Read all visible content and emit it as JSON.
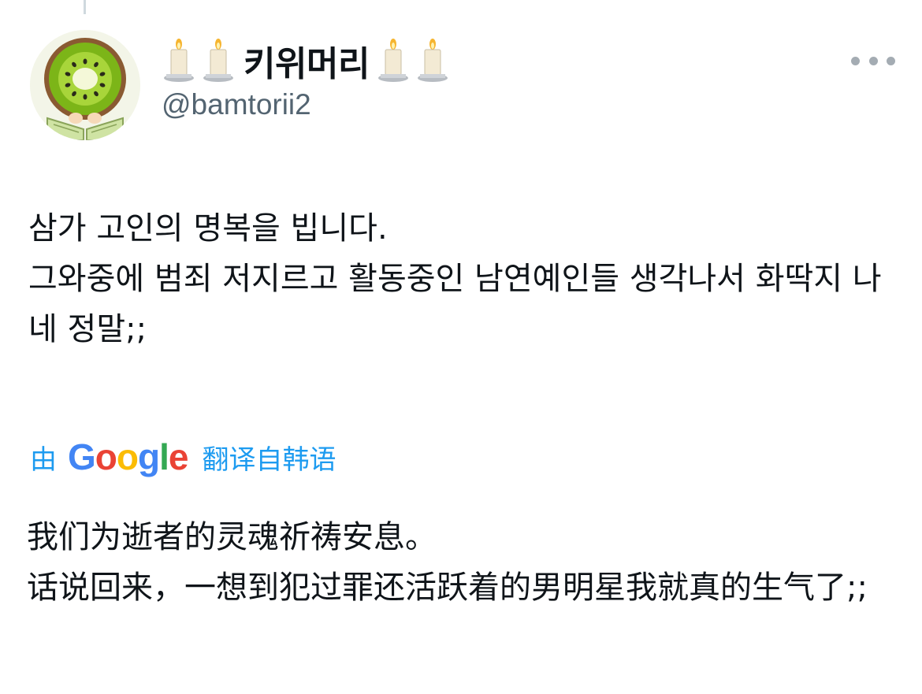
{
  "author": {
    "display_name": "키위머리",
    "handle": "@bamtorii2",
    "avatar_icon": "kiwi-avatar-icon",
    "name_decoration_icon": "candle-icon"
  },
  "actions": {
    "more_icon": "more-horizontal-icon"
  },
  "tweet": {
    "lines": [
      "삼가 고인의 명복을 빕니다.",
      "그와중에 범죄 저지르고 활동중인 남연예인들 생각나서 화딱지 나네 정말;;"
    ]
  },
  "translation": {
    "by_label": "由",
    "provider": {
      "letters": [
        "G",
        "o",
        "o",
        "g",
        "l",
        "e"
      ],
      "colors": [
        "#4285f4",
        "#ea4335",
        "#fbbc05",
        "#4285f4",
        "#34a853",
        "#ea4335"
      ]
    },
    "source_label": "翻译自韩语",
    "lines": [
      "我们为逝者的灵魂祈祷安息。",
      "话说回来，一想到犯过罪还活跃着的男明星我就真的生气了;;"
    ]
  },
  "colors": {
    "link": "#1d9bf0",
    "text": "#0f1419",
    "secondary": "#536471"
  }
}
